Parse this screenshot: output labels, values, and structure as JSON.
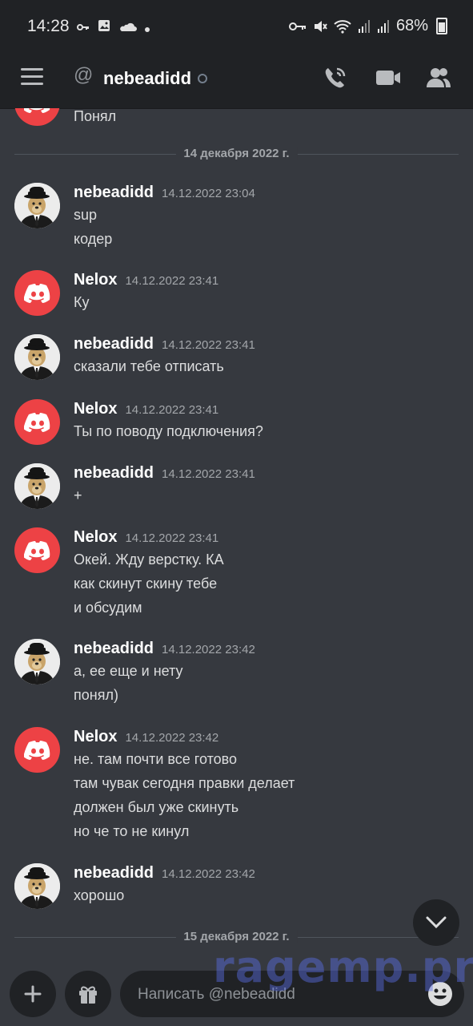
{
  "status_bar": {
    "time": "14:28",
    "battery_percent": "68%"
  },
  "header": {
    "channel_name": "nebeadidd",
    "at_symbol": "@"
  },
  "messages_top_fragment": "Понял",
  "dividers": {
    "first": "14 декабря 2022 г.",
    "second": "15 декабря 2022 г."
  },
  "messages": [
    {
      "author": "nebeadidd",
      "timestamp": "14.12.2022 23:04",
      "avatar": "dog-in-suit",
      "lines": [
        "sup",
        "кодер"
      ]
    },
    {
      "author": "Nelox",
      "timestamp": "14.12.2022 23:41",
      "avatar": "discord-logo",
      "lines": [
        "Ку"
      ]
    },
    {
      "author": "nebeadidd",
      "timestamp": "14.12.2022 23:41",
      "avatar": "dog-in-suit",
      "lines": [
        "сказали тебе отписать"
      ]
    },
    {
      "author": "Nelox",
      "timestamp": "14.12.2022 23:41",
      "avatar": "discord-logo",
      "lines": [
        "Ты по поводу подключения?"
      ]
    },
    {
      "author": "nebeadidd",
      "timestamp": "14.12.2022 23:41",
      "avatar": "dog-in-suit",
      "lines": [
        "+"
      ]
    },
    {
      "author": "Nelox",
      "timestamp": "14.12.2022 23:41",
      "avatar": "discord-logo",
      "lines": [
        "Окей. Жду верстку. КА",
        "как скинут скину тебе",
        "и обсудим"
      ]
    },
    {
      "author": "nebeadidd",
      "timestamp": "14.12.2022 23:42",
      "avatar": "dog-in-suit",
      "lines": [
        "а, ее еще и нету",
        "понял)"
      ]
    },
    {
      "author": "Nelox",
      "timestamp": "14.12.2022 23:42",
      "avatar": "discord-logo",
      "lines": [
        "не. там почти все готово",
        "там чувак сегодня правки делает",
        "должен был уже скинуть",
        "но че то не кинул"
      ]
    },
    {
      "author": "nebeadidd",
      "timestamp": "14.12.2022 23:42",
      "avatar": "dog-in-suit",
      "lines": [
        "хорошо"
      ]
    }
  ],
  "composer": {
    "placeholder": "Написать @nebeadidd"
  },
  "watermark": "ragemp.pro",
  "colors": {
    "background": "#36393f",
    "bar": "#202225",
    "discord_red": "#ed4245"
  }
}
